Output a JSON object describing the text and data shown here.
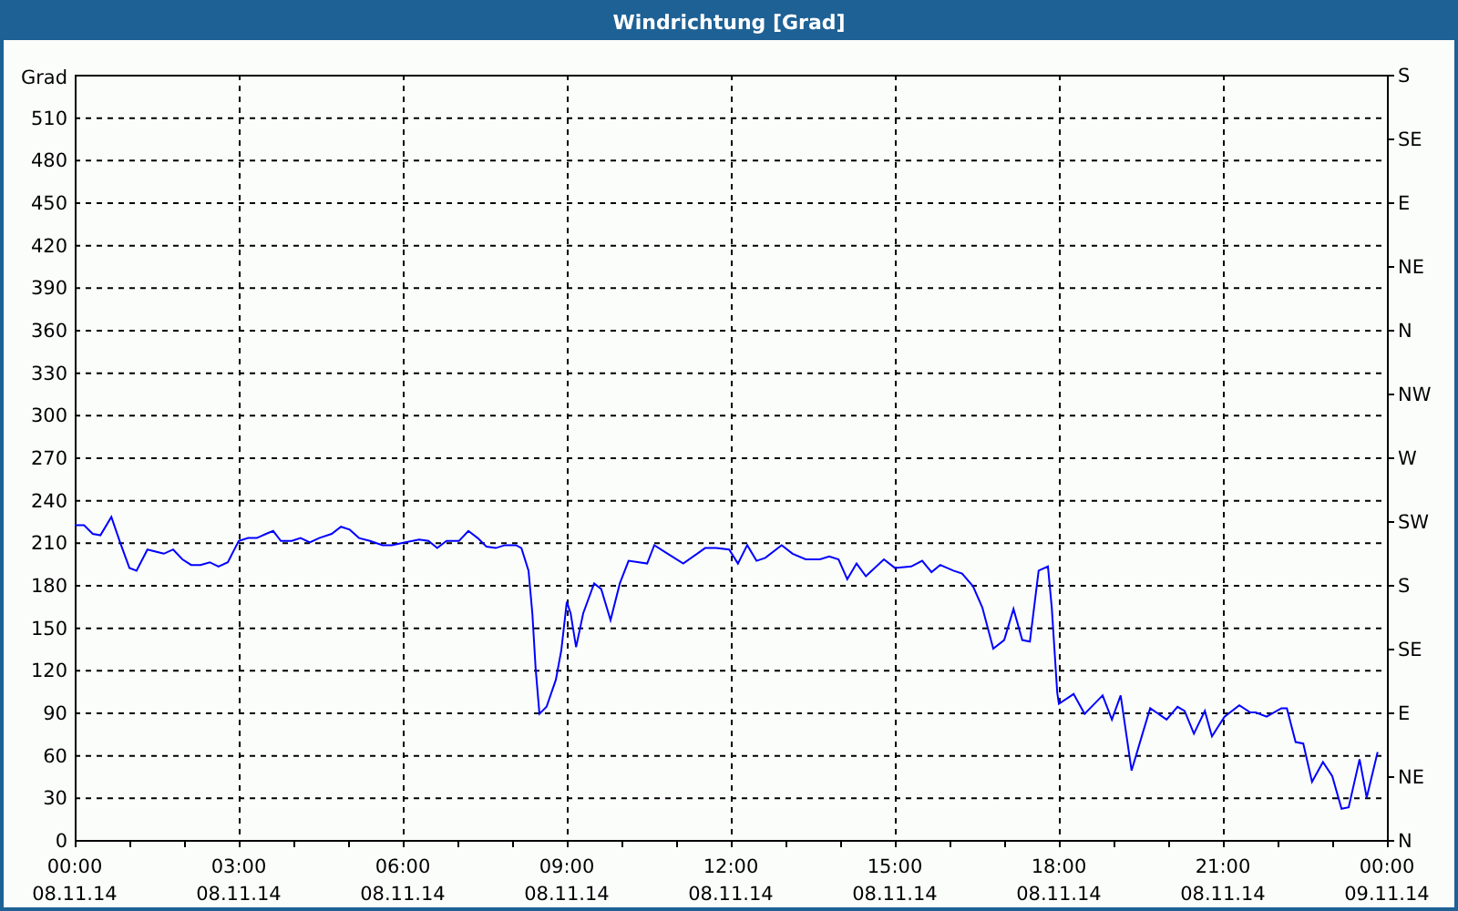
{
  "window": {
    "title": "Windrichtung [Grad]"
  },
  "chart": {
    "chart_data": {
      "type": "line",
      "ylabel": "Grad",
      "xlim": [
        0,
        24
      ],
      "ylim": [
        0,
        540
      ],
      "grid": true,
      "xticks": [
        {
          "value": 0,
          "label": "00:00"
        },
        {
          "value": 3,
          "label": "03:00"
        },
        {
          "value": 6,
          "label": "06:00"
        },
        {
          "value": 9,
          "label": "09:00"
        },
        {
          "value": 12,
          "label": "12:00"
        },
        {
          "value": 15,
          "label": "15:00"
        },
        {
          "value": 18,
          "label": "18:00"
        },
        {
          "value": 21,
          "label": "21:00"
        },
        {
          "value": 24,
          "label": "00:00"
        }
      ],
      "yticks": [
        0,
        30,
        60,
        90,
        120,
        150,
        180,
        210,
        240,
        270,
        300,
        330,
        360,
        390,
        420,
        450,
        480,
        510
      ],
      "x": [
        0,
        0.17,
        0.33,
        0.47,
        0.67,
        0.83,
        1,
        1.13,
        1.33,
        1.53,
        1.63,
        1.8,
        1.97,
        2.13,
        2.3,
        2.47,
        2.63,
        2.8,
        3,
        3.17,
        3.33,
        3.5,
        3.63,
        3.77,
        3.97,
        4.13,
        4.3,
        4.47,
        4.7,
        4.87,
        5.03,
        5.2,
        5.4,
        5.63,
        5.8,
        6.03,
        6.3,
        6.47,
        6.63,
        6.8,
        7.03,
        7.2,
        7.37,
        7.53,
        7.7,
        7.87,
        8.07,
        8.17,
        8.3,
        8.37,
        8.43,
        8.5,
        8.63,
        8.8,
        8.9,
        9,
        9.07,
        9.17,
        9.3,
        9.5,
        9.63,
        9.8,
        9.97,
        10.13,
        10.47,
        10.6,
        10.8,
        11.13,
        11.53,
        11.73,
        11.97,
        12.13,
        12.3,
        12.47,
        12.63,
        12.93,
        13.13,
        13.37,
        13.63,
        13.8,
        13.97,
        14.13,
        14.3,
        14.47,
        14.8,
        15,
        15.3,
        15.5,
        15.67,
        15.83,
        16.07,
        16.23,
        16.43,
        16.6,
        16.8,
        17,
        17.17,
        17.33,
        17.47,
        17.63,
        17.8,
        17.87,
        17.97,
        18,
        18.27,
        18.47,
        18.8,
        18.97,
        19.13,
        19.33,
        19.53,
        19.67,
        19.97,
        20.17,
        20.3,
        20.47,
        20.67,
        20.8,
        21.03,
        21.3,
        21.5,
        21.6,
        21.8,
        22.07,
        22.17,
        22.33,
        22.47,
        22.63,
        22.83,
        23,
        23.17,
        23.3,
        23.5,
        23.63,
        23.83
      ],
      "series": [
        {
          "color": "#0000ff",
          "values": [
            222,
            222,
            216,
            215,
            228,
            210,
            192,
            190,
            205,
            203,
            202,
            205,
            198,
            194,
            194,
            196,
            193,
            196,
            211,
            213,
            213,
            216,
            218,
            211,
            211,
            213,
            210,
            213,
            216,
            221,
            219,
            213,
            211,
            208,
            208,
            210,
            212,
            211,
            206,
            211,
            211,
            218,
            213,
            207,
            206,
            208,
            208,
            206,
            190,
            160,
            121,
            89,
            94,
            113,
            134,
            168,
            160,
            136,
            160,
            181,
            177,
            155,
            181,
            197,
            195,
            208,
            203,
            195,
            206,
            206,
            205,
            195,
            208,
            197,
            199,
            208,
            202,
            198,
            198,
            200,
            198,
            184,
            195,
            186,
            198,
            192,
            193,
            197,
            189,
            194,
            190,
            188,
            179,
            164,
            135,
            141,
            163,
            141,
            140,
            190,
            193,
            164,
            104,
            96,
            103,
            89,
            102,
            85,
            102,
            49,
            75,
            93,
            85,
            94,
            91,
            75,
            91,
            73,
            87,
            95,
            90,
            90,
            87,
            93,
            93,
            69,
            68,
            41,
            55,
            45,
            22,
            23,
            57,
            30,
            62
          ]
        }
      ]
    },
    "x_dates": [
      "08.11.14",
      "08.11.14",
      "08.11.14",
      "08.11.14",
      "08.11.14",
      "08.11.14",
      "08.11.14",
      "08.11.14",
      "09.11.14"
    ],
    "right_axis": {
      "labels": [
        "S",
        "SE",
        "E",
        "NE",
        "N",
        "NW",
        "W",
        "SW",
        "S",
        "SE",
        "E",
        "NE",
        "N"
      ]
    }
  }
}
